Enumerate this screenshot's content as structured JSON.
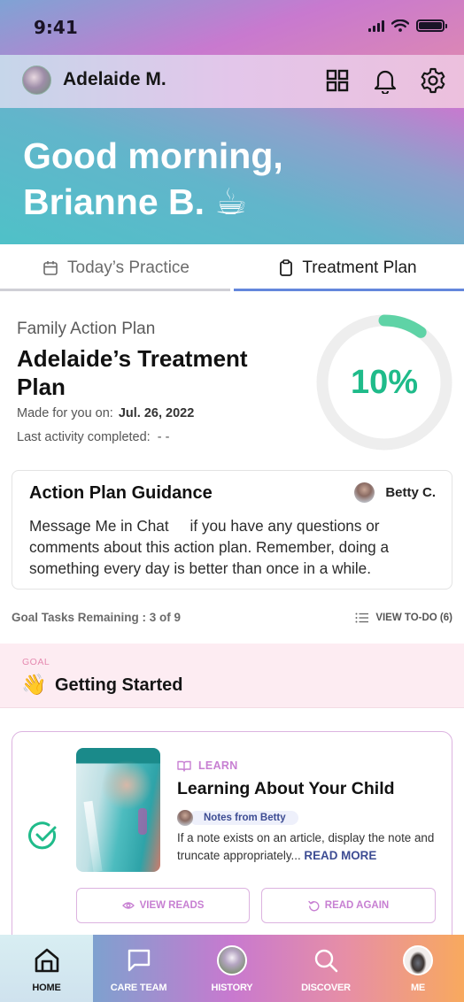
{
  "status_bar": {
    "time": "9:41"
  },
  "header": {
    "profile_name": "Adelaide M.",
    "icons": [
      "grid-icon",
      "bell-icon",
      "gear-icon"
    ]
  },
  "hero": {
    "greeting_line1": "Good morning,",
    "greeting_line2": "Brianne B. ☕"
  },
  "tabs": [
    {
      "label": "Today’s Practice",
      "icon": "calendar-icon",
      "active": false
    },
    {
      "label": "Treatment Plan",
      "icon": "clipboard-icon",
      "active": true
    }
  ],
  "plan": {
    "subtitle": "Family Action Plan",
    "title": "Adelaide’s Treatment Plan",
    "made_for_label": "Made for you on:",
    "made_for_value": "Jul. 26, 2022",
    "last_activity_label": "Last activity completed:",
    "last_activity_value": "- -",
    "progress_percent": 10,
    "progress_label": "10%",
    "progress_color": "#5fd3a6",
    "track_color": "#eeeeee"
  },
  "guidance": {
    "title": "Action Plan Guidance",
    "author": "Betty C.",
    "body": "Message Me in Chat     if you have any questions or comments about this action plan. Remember, doing a something every day is better than once in a while."
  },
  "tasks": {
    "remaining": "Goal Tasks Remaining : 3 of 9",
    "view_todo": "VIEW TO-DO (6)"
  },
  "goal": {
    "label": "GOAL",
    "emoji": "👋",
    "title": "Getting Started"
  },
  "activity": {
    "completed": true,
    "type_label": "LEARN",
    "title": "Learning About Your Child",
    "notes_label": "Notes from Betty",
    "note_text": "If a note exists on an article, display the note and truncate appropriately...",
    "read_more": "READ MORE",
    "view_reads": "VIEW READS",
    "read_again": "READ AGAIN"
  },
  "bottom_nav": [
    {
      "label": "HOME",
      "icon": "home-icon",
      "active": true
    },
    {
      "label": "CARE TEAM",
      "icon": "chat-icon",
      "active": false
    },
    {
      "label": "HISTORY",
      "icon": "history-avatar",
      "active": false
    },
    {
      "label": "DISCOVER",
      "icon": "search-icon",
      "active": false
    },
    {
      "label": "ME",
      "icon": "profile-avatar",
      "active": false
    }
  ],
  "colors": {
    "accent_green": "#1fbb8a",
    "accent_purple": "#c77fd2",
    "tab_active": "#6487dc",
    "note_blue": "#3d4c93"
  }
}
